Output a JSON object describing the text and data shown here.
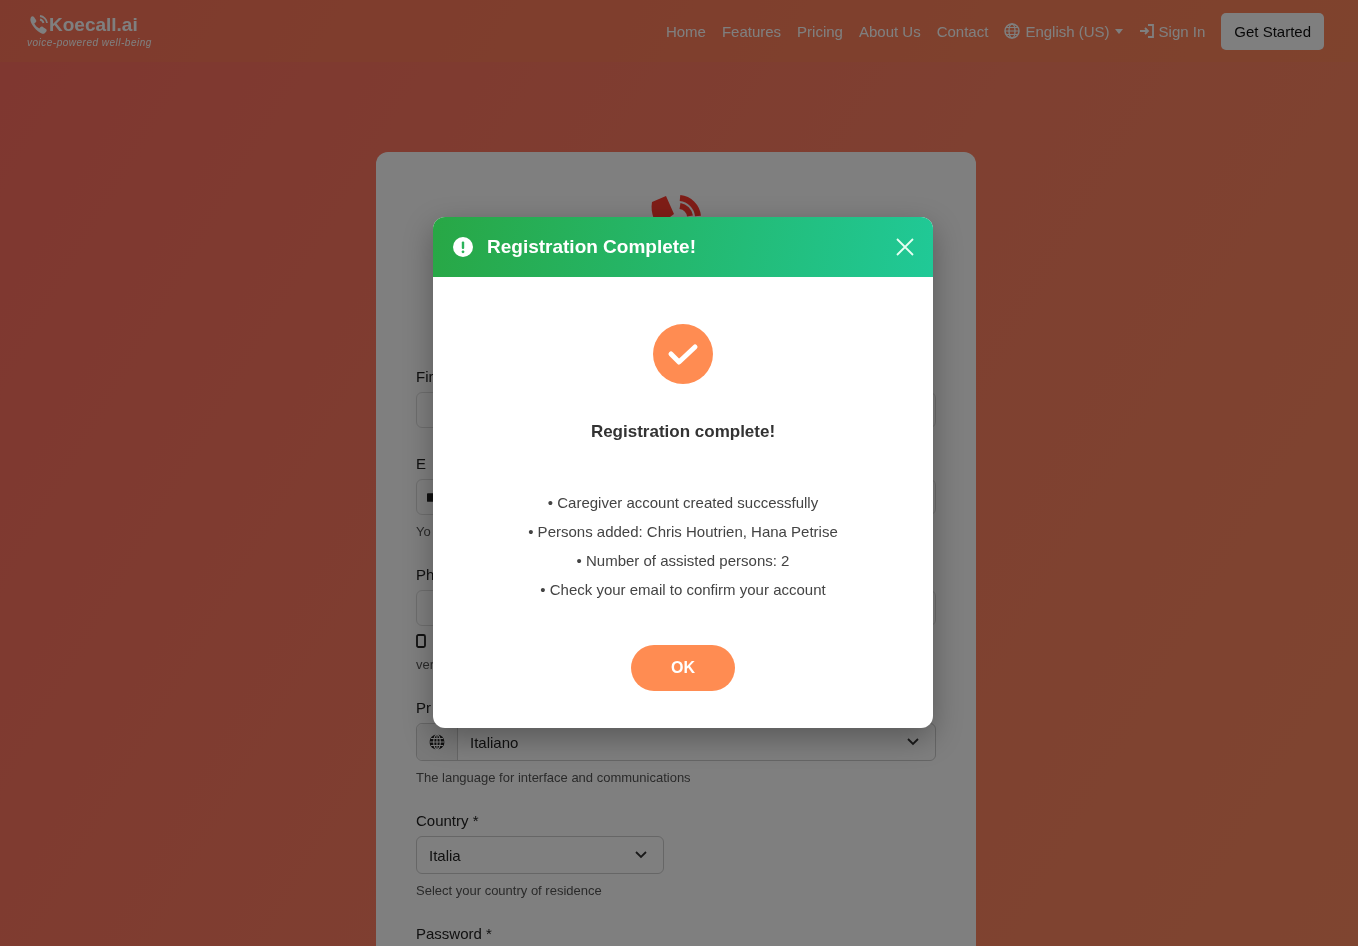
{
  "navbar": {
    "brand": "Koecall.ai",
    "tagline": "voice-powered well-being",
    "links": [
      "Home",
      "Features",
      "Pricing",
      "About Us",
      "Contact"
    ],
    "language": "English (US)",
    "sign_in": "Sign In",
    "cta": "Get Started"
  },
  "form": {
    "fields": [
      {
        "kind": "text",
        "label": "Fir"
      },
      {
        "kind": "email",
        "label": "E",
        "hint": "Yo"
      },
      {
        "kind": "phone",
        "label": "Ph",
        "hint": "ver"
      },
      {
        "kind": "language-select",
        "label": "Pr",
        "value": "Italiano",
        "hint": "The language for interface and communications"
      },
      {
        "kind": "select",
        "label": "Country *",
        "value": "Italia",
        "hint": "Select your country of residence"
      },
      {
        "kind": "heading",
        "label": "Password *"
      }
    ]
  },
  "modal": {
    "title": "Registration Complete!",
    "heading": "Registration complete!",
    "lines": [
      "• Caregiver account created successfully",
      "• Persons added: Chris Houtrien, Hana Petrise",
      "• Number of assisted persons: 2",
      "• Check your email to confirm your account"
    ],
    "ok": "OK"
  }
}
